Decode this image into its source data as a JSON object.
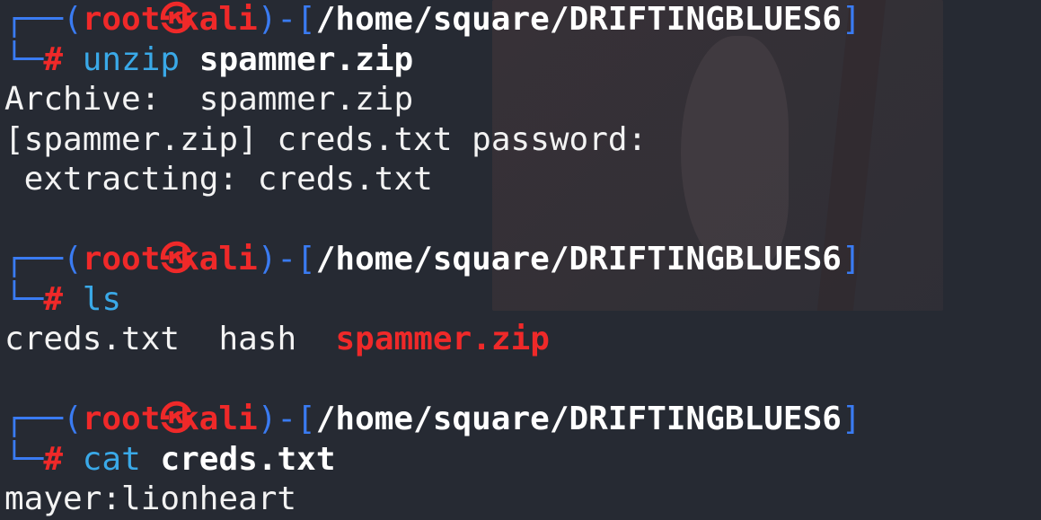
{
  "prompt": {
    "user": "root",
    "skull_glyph": "㉿",
    "host": "kali",
    "path": "/home/square/DRIFTINGBLUES6",
    "hash": "#"
  },
  "blocks": [
    {
      "command": "unzip",
      "argument": "spammer.zip",
      "output": [
        "Archive:  spammer.zip",
        "[spammer.zip] creds.txt password:",
        " extracting: creds.txt"
      ]
    },
    {
      "command": "ls",
      "argument": "",
      "ls_output": {
        "file1": "creds.txt",
        "file2": "hash",
        "file3": "spammer.zip"
      }
    },
    {
      "command": "cat",
      "argument": "creds.txt",
      "output": [
        "mayer:lionheart"
      ]
    }
  ],
  "colors": {
    "background": "#262a33",
    "frame_blue": "#3a7bf2",
    "prompt_red": "#ef2929",
    "command_blue": "#3aa9e8",
    "text": "#f3f3f3"
  }
}
